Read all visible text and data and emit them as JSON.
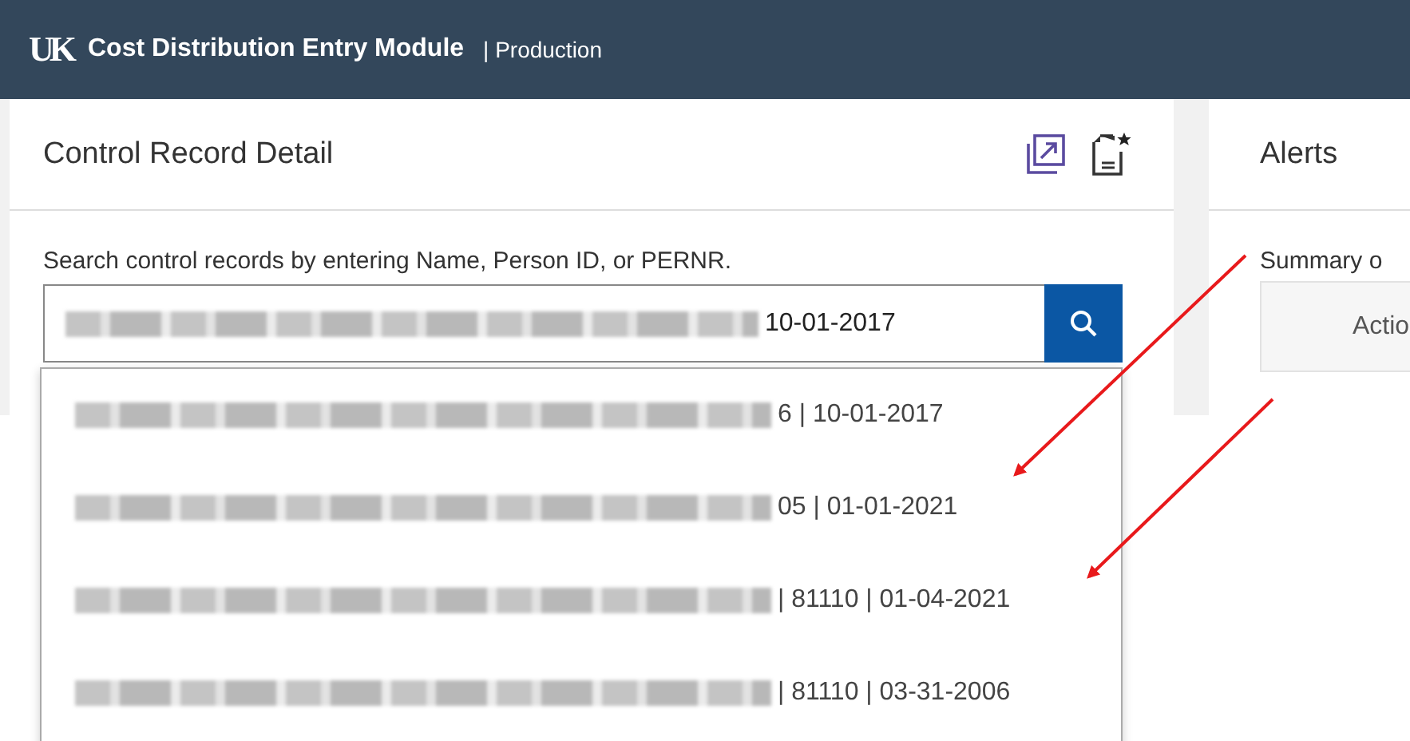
{
  "header": {
    "logo_text": "UK",
    "title": "Cost Distribution Entry Module",
    "environment": "| Production"
  },
  "control_record": {
    "title": "Control Record Detail",
    "search_label": "Search control records by entering Name, Person ID, or PERNR.",
    "search_value": "10-01-2017",
    "results": [
      {
        "visible_text": "6 | 10-01-2017"
      },
      {
        "visible_text": "05 | 01-01-2021"
      },
      {
        "visible_text": "| 81110 | 01-04-2021"
      },
      {
        "visible_text": "| 81110 | 03-31-2006"
      }
    ]
  },
  "alerts": {
    "title": "Alerts",
    "summary_label": "Summary o",
    "action_text": "Actio"
  }
}
